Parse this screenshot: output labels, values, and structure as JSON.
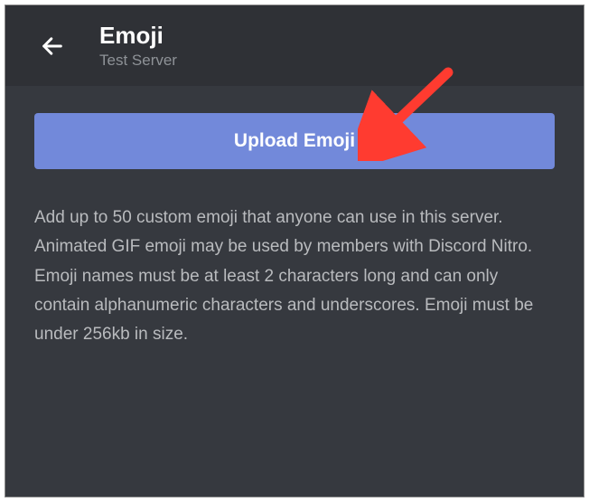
{
  "header": {
    "title": "Emoji",
    "server_name": "Test Server"
  },
  "main": {
    "upload_button_label": "Upload Emoji",
    "description": "Add up to 50 custom emoji that anyone can use in this server. Animated GIF emoji may be used by members with Discord Nitro. Emoji names must be at least 2 characters long and can only contain alphanumeric characters and underscores. Emoji must be under 256kb in size."
  },
  "colors": {
    "background_dark": "#2f3136",
    "background_main": "#36393f",
    "button_primary": "#7289da",
    "text_primary": "#ffffff",
    "text_muted": "#8e9297",
    "text_body": "#b9bbbe",
    "annotation_arrow": "#ff3b30"
  }
}
